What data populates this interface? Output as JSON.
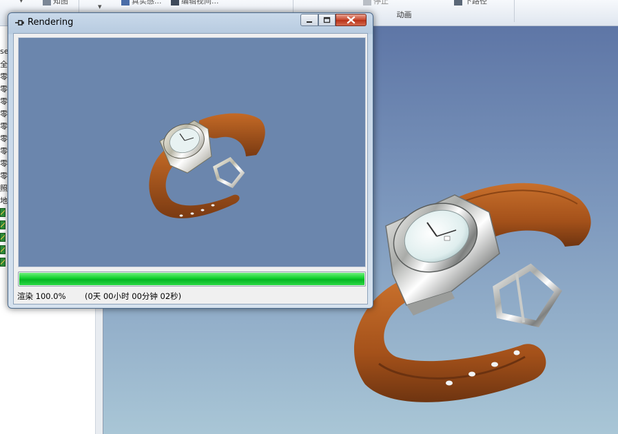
{
  "ribbon": {
    "animation_group_label": "动画",
    "partial_buttons": [
      "知图",
      "真实感...",
      "编辑视间...",
      "停止",
      "下路径"
    ]
  },
  "left_panel": {
    "rows": [
      "se",
      "全局",
      "零件",
      "零件",
      "零件",
      "零件",
      "零件",
      "零件",
      "零件",
      "零件",
      "零件",
      "照相",
      "地灵"
    ]
  },
  "dialog": {
    "title": "Rendering",
    "progress": 1.0,
    "status_percent": "渲染 100.0%",
    "status_elapsed": "(0天 00小时 00分钟 02秒)"
  },
  "colors": {
    "strap": "#b45a1e",
    "progress_green": "#0fcf2c",
    "viewport_top": "#5e76a6",
    "viewport_bottom": "#a9c6d6",
    "preview_bg": "#6b86ad"
  },
  "icons": {
    "title": "pin-icon",
    "minimize": "minimize-icon",
    "maximize": "maximize-icon",
    "close": "close-icon"
  }
}
